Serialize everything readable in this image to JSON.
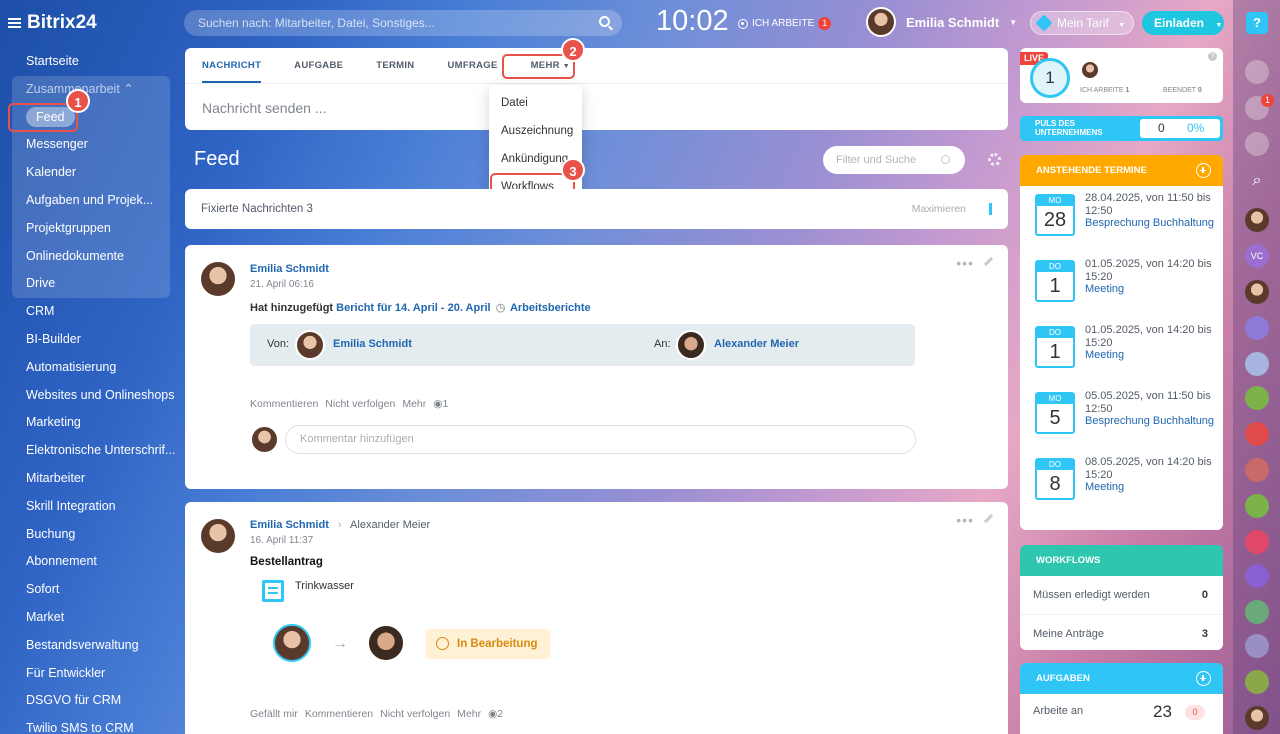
{
  "app": {
    "title": "Bitrix24"
  },
  "topbar": {
    "search_placeholder": "Suchen nach: Mitarbeiter, Datei, Sonstiges...",
    "time": "10:02",
    "work_status": "ICH ARBEITE",
    "work_badge": "1",
    "user_name": "Emilia Schmidt",
    "tarif": "Mein Tarif",
    "invite": "Einladen"
  },
  "sidebar": {
    "items": [
      "Startseite",
      "Zusammenarbeit",
      "Feed",
      "Messenger",
      "Kalender",
      "Aufgaben und Projek...",
      "Projektgruppen",
      "Onlinedokumente",
      "Drive",
      "CRM",
      "BI-Builder",
      "Automatisierung",
      "Websites und Onlineshops",
      "Marketing",
      "Elektronische Unterschrif...",
      "Mitarbeiter",
      "Skrill Integration",
      "Buchung",
      "Abonnement",
      "Sofort",
      "Market",
      "Bestandsverwaltung",
      "Für Entwickler",
      "DSGVO für CRM",
      "Twilio SMS to CRM"
    ]
  },
  "callouts": [
    "1",
    "2",
    "3"
  ],
  "composer": {
    "tabs": [
      "NACHRICHT",
      "AUFGABE",
      "TERMIN",
      "UMFRAGE",
      "MEHR"
    ],
    "placeholder": "Nachricht senden ...",
    "more_menu": [
      "Datei",
      "Auszeichnung",
      "Ankündigung",
      "Workflows"
    ]
  },
  "feed": {
    "title": "Feed",
    "filter_placeholder": "Filter und Suche",
    "pinned_label": "Fixierte Nachrichten",
    "pinned_count": "3",
    "maximize": "Maximieren"
  },
  "post1": {
    "author": "Emilia Schmidt",
    "date": "21. April 06:16",
    "text_prefix": "Hat hinzugefügt",
    "report_link": "Bericht für 14. April - 20. April",
    "category": "Arbeitsberichte",
    "from_label": "Von:",
    "from_name": "Emilia Schmidt",
    "to_label": "An:",
    "to_name": "Alexander Meier",
    "actions": [
      "Kommentieren",
      "Nicht verfolgen",
      "Mehr"
    ],
    "views": "1",
    "comment_placeholder": "Kommentar hinzufügen"
  },
  "post2": {
    "author": "Emilia Schmidt",
    "recipient": "Alexander Meier",
    "date": "16. April 11:37",
    "title": "Bestellantrag",
    "item": "Trinkwasser",
    "status": "In Bearbeitung",
    "actions": [
      "Gefällt mir",
      "Kommentieren",
      "Nicht verfolgen",
      "Mehr"
    ],
    "views": "2"
  },
  "right": {
    "live": "LIVE",
    "pulse_count": "1",
    "working_label": "ICH ARBEITE",
    "working_count": "1",
    "finished_label": "BEENDET",
    "finished_count": "0",
    "pulse_label": "PULS DES UNTERNEHMENS",
    "pulse_value": "0",
    "pulse_pct": "0%",
    "events_header": "ANSTEHENDE TERMINE",
    "events": [
      {
        "day": "MO",
        "num": "28",
        "time": "28.04.2025, von 11:50 bis 12:50",
        "title": "Besprechung Buchhaltung"
      },
      {
        "day": "DO",
        "num": "1",
        "time": "01.05.2025, von 14:20 bis 15:20",
        "title": "Meeting"
      },
      {
        "day": "DO",
        "num": "1",
        "time": "01.05.2025, von 14:20 bis 15:20",
        "title": "Meeting"
      },
      {
        "day": "MO",
        "num": "5",
        "time": "05.05.2025, von 11:50 bis 12:50",
        "title": "Besprechung Buchhaltung"
      },
      {
        "day": "DO",
        "num": "8",
        "time": "08.05.2025, von 14:20 bis 15:20",
        "title": "Meeting"
      }
    ],
    "workflows_header": "WORKFLOWS",
    "wf_rows": [
      {
        "label": "Müssen erledigt werden",
        "value": "0"
      },
      {
        "label": "Meine Anträge",
        "value": "3"
      }
    ],
    "tasks_header": "AUFGABEN",
    "task_label": "Arbeite an",
    "task_count": "23",
    "task_badge": "0"
  },
  "farbar": {
    "help": "?",
    "notify_badge": "1",
    "vc": "VC"
  }
}
